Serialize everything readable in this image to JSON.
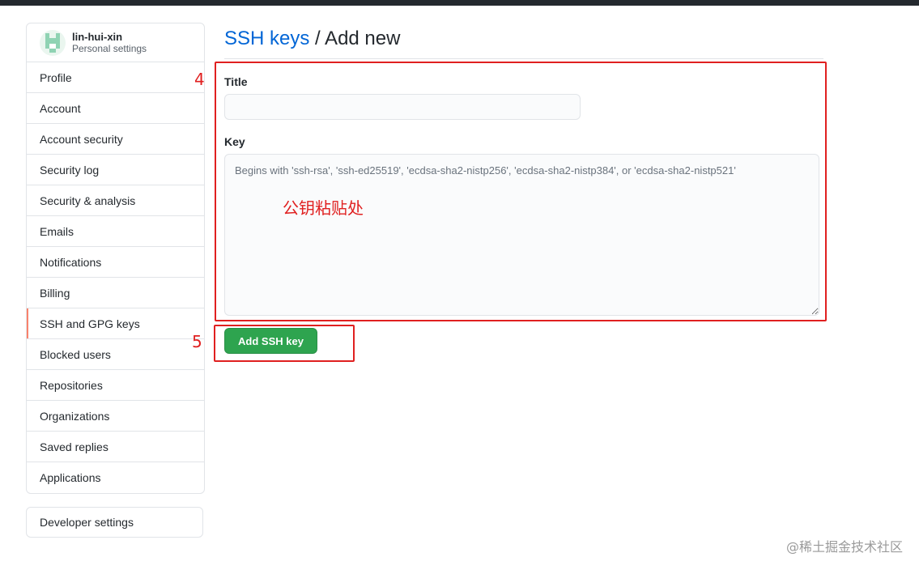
{
  "sidebar": {
    "user": {
      "name": "lin-hui-xin",
      "subtitle": "Personal settings"
    },
    "items": [
      {
        "label": "Profile",
        "selected": false
      },
      {
        "label": "Account",
        "selected": false
      },
      {
        "label": "Account security",
        "selected": false
      },
      {
        "label": "Security log",
        "selected": false
      },
      {
        "label": "Security & analysis",
        "selected": false
      },
      {
        "label": "Emails",
        "selected": false
      },
      {
        "label": "Notifications",
        "selected": false
      },
      {
        "label": "Billing",
        "selected": false
      },
      {
        "label": "SSH and GPG keys",
        "selected": true
      },
      {
        "label": "Blocked users",
        "selected": false
      },
      {
        "label": "Repositories",
        "selected": false
      },
      {
        "label": "Organizations",
        "selected": false
      },
      {
        "label": "Saved replies",
        "selected": false
      },
      {
        "label": "Applications",
        "selected": false
      }
    ],
    "developer_settings": "Developer settings"
  },
  "main": {
    "breadcrumb_link": "SSH keys",
    "breadcrumb_rest": " / Add new",
    "title_label": "Title",
    "title_value": "",
    "key_label": "Key",
    "key_value": "",
    "key_placeholder": "Begins with 'ssh-rsa', 'ssh-ed25519', 'ecdsa-sha2-nistp256', 'ecdsa-sha2-nistp384', or 'ecdsa-sha2-nistp521'",
    "submit_label": "Add SSH key"
  },
  "annotations": {
    "step_form": "4",
    "step_button": "5",
    "paste_note": "公钥粘贴处",
    "color": "#e02020"
  },
  "watermark": "@稀土掘金技术社区",
  "icons": {
    "avatar": "identicon-avatar"
  }
}
